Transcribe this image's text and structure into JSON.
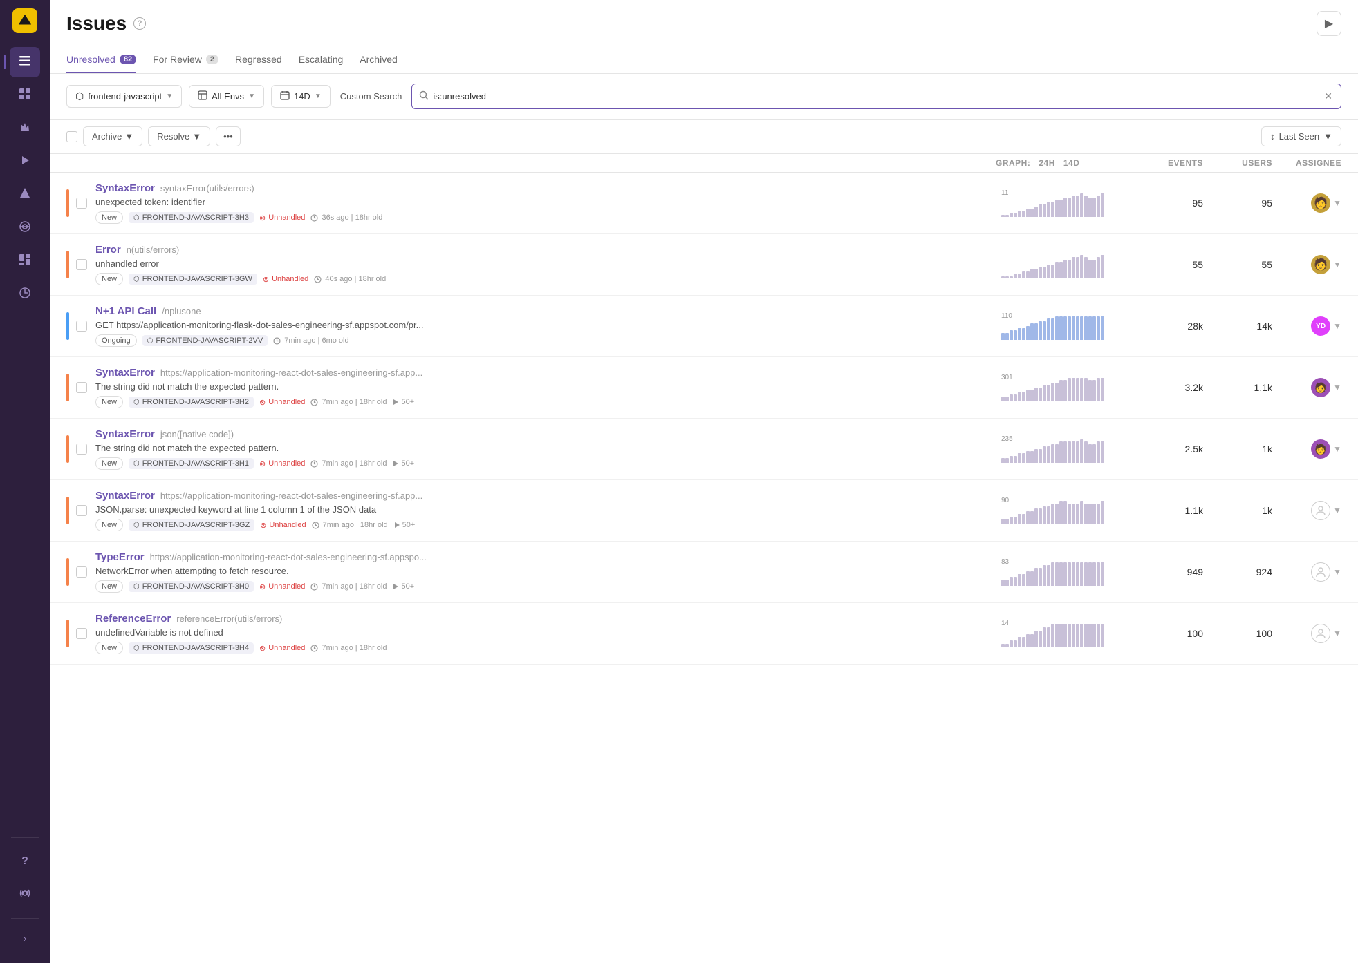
{
  "sidebar": {
    "logo_icon": "◆",
    "items": [
      {
        "id": "issues",
        "icon": "☰",
        "active": true
      },
      {
        "id": "releases",
        "icon": "▣"
      },
      {
        "id": "performance",
        "icon": "⚡"
      },
      {
        "id": "replays",
        "icon": "▶"
      },
      {
        "id": "alerts",
        "icon": "🔔"
      },
      {
        "id": "discover",
        "icon": "⊞"
      },
      {
        "id": "dashboards",
        "icon": "▦"
      },
      {
        "id": "crons",
        "icon": "⏱"
      }
    ],
    "bottom_items": [
      {
        "id": "help",
        "icon": "?"
      },
      {
        "id": "broadcasts",
        "icon": "📡"
      }
    ],
    "collapse_icon": "‹"
  },
  "header": {
    "title": "Issues",
    "help_icon": "?",
    "play_icon": "▶"
  },
  "tabs": [
    {
      "id": "unresolved",
      "label": "Unresolved",
      "badge": "82",
      "active": true
    },
    {
      "id": "for-review",
      "label": "For Review",
      "badge": "2",
      "active": false
    },
    {
      "id": "regressed",
      "label": "Regressed",
      "badge": null,
      "active": false
    },
    {
      "id": "escalating",
      "label": "Escalating",
      "badge": null,
      "active": false
    },
    {
      "id": "archived",
      "label": "Archived",
      "badge": null,
      "active": false
    }
  ],
  "filters": {
    "project": "frontend-javascript",
    "project_icon": "⬡",
    "env": "All Envs",
    "time": "14D",
    "custom_search_label": "Custom Search",
    "search_placeholder": "is:unresolved",
    "search_value": "is:unresolved"
  },
  "actions": {
    "archive_label": "Archive",
    "resolve_label": "Resolve",
    "more_icon": "•••",
    "sort_label": "Last Seen",
    "sort_icon": "↕"
  },
  "table_headers": {
    "graph_label": "GRAPH:",
    "graph_24h": "24h",
    "graph_14d": "14d",
    "events": "EVENTS",
    "users": "USERS",
    "assignee": "ASSIGNEE"
  },
  "issues": [
    {
      "id": 1,
      "priority": "orange",
      "type": "SyntaxError",
      "location": "syntaxError(utils/errors)",
      "description": "unexpected token: identifier",
      "badge_status": "New",
      "project_code": "FRONTEND-JAVASCRIPT-3H3",
      "unhandled": true,
      "time": "36s ago",
      "age": "18hr old",
      "plays": null,
      "graph_max": "11",
      "graph_bars": [
        1,
        1,
        2,
        2,
        3,
        3,
        4,
        4,
        5,
        6,
        6,
        7,
        7,
        8,
        8,
        9,
        9,
        10,
        10,
        11,
        10,
        9,
        9,
        10,
        11
      ],
      "events": "95",
      "users": "95",
      "assignee_type": "avatar",
      "assignee_color": "#c4a03a"
    },
    {
      "id": 2,
      "priority": "orange",
      "type": "Error",
      "location": "n(utils/errors)",
      "description": "unhandled error",
      "badge_status": "New",
      "project_code": "FRONTEND-JAVASCRIPT-3GW",
      "unhandled": true,
      "time": "40s ago",
      "age": "18hr old",
      "plays": null,
      "graph_max": "",
      "graph_bars": [
        1,
        1,
        1,
        2,
        2,
        3,
        3,
        4,
        4,
        5,
        5,
        6,
        6,
        7,
        7,
        8,
        8,
        9,
        9,
        10,
        9,
        8,
        8,
        9,
        10
      ],
      "events": "55",
      "users": "55",
      "assignee_type": "avatar",
      "assignee_color": "#c4a03a"
    },
    {
      "id": 3,
      "priority": "blue",
      "type": "N+1 API Call",
      "location": "/nplusone",
      "description": "GET https://application-monitoring-flask-dot-sales-engineering-sf.appspot.com/pr...",
      "badge_status": "Ongoing",
      "project_code": "FRONTEND-JAVASCRIPT-2VV",
      "unhandled": false,
      "time": "7min ago",
      "age": "6mo old",
      "plays": null,
      "graph_max": "110",
      "graph_bars": [
        3,
        3,
        4,
        4,
        5,
        5,
        6,
        7,
        7,
        8,
        8,
        9,
        9,
        10,
        10,
        10,
        10,
        10,
        10,
        10,
        10,
        10,
        10,
        10,
        10
      ],
      "events": "28k",
      "users": "14k",
      "assignee_type": "yd",
      "assignee_initials": "YD",
      "assignee_color": "#e040fb"
    },
    {
      "id": 4,
      "priority": "orange",
      "type": "SyntaxError",
      "location": "https://application-monitoring-react-dot-sales-engineering-sf.app...",
      "description": "The string did not match the expected pattern.",
      "badge_status": "New",
      "project_code": "FRONTEND-JAVASCRIPT-3H2",
      "unhandled": true,
      "time": "7min ago",
      "age": "18hr old",
      "plays": "50+",
      "graph_max": "301",
      "graph_bars": [
        2,
        2,
        3,
        3,
        4,
        4,
        5,
        5,
        6,
        6,
        7,
        7,
        8,
        8,
        9,
        9,
        10,
        10,
        10,
        10,
        10,
        9,
        9,
        10,
        10
      ],
      "events": "3.2k",
      "users": "1.1k",
      "assignee_type": "avatar-purple",
      "assignee_color": "#9c4fb5"
    },
    {
      "id": 5,
      "priority": "orange",
      "type": "SyntaxError",
      "location": "json([native code])",
      "description": "The string did not match the expected pattern.",
      "badge_status": "New",
      "project_code": "FRONTEND-JAVASCRIPT-3H1",
      "unhandled": true,
      "time": "7min ago",
      "age": "18hr old",
      "plays": "50+",
      "graph_max": "235",
      "graph_bars": [
        2,
        2,
        3,
        3,
        4,
        4,
        5,
        5,
        6,
        6,
        7,
        7,
        8,
        8,
        9,
        9,
        9,
        9,
        9,
        10,
        9,
        8,
        8,
        9,
        9
      ],
      "events": "2.5k",
      "users": "1k",
      "assignee_type": "avatar-purple",
      "assignee_color": "#9c4fb5"
    },
    {
      "id": 6,
      "priority": "orange",
      "type": "SyntaxError",
      "location": "https://application-monitoring-react-dot-sales-engineering-sf.app...",
      "description": "JSON.parse: unexpected keyword at line 1 column 1 of the JSON data",
      "badge_status": "New",
      "project_code": "FRONTEND-JAVASCRIPT-3GZ",
      "unhandled": true,
      "time": "7min ago",
      "age": "18hr old",
      "plays": "50+",
      "graph_max": "90",
      "graph_bars": [
        2,
        2,
        3,
        3,
        4,
        4,
        5,
        5,
        6,
        6,
        7,
        7,
        8,
        8,
        9,
        9,
        8,
        8,
        8,
        9,
        8,
        8,
        8,
        8,
        9
      ],
      "events": "1.1k",
      "users": "1k",
      "assignee_type": "placeholder",
      "assignee_color": null
    },
    {
      "id": 7,
      "priority": "orange",
      "type": "TypeError",
      "location": "https://application-monitoring-react-dot-sales-engineering-sf.appspo...",
      "description": "NetworkError when attempting to fetch resource.",
      "badge_status": "New",
      "project_code": "FRONTEND-JAVASCRIPT-3H0",
      "unhandled": true,
      "time": "7min ago",
      "age": "18hr old",
      "plays": "50+",
      "graph_max": "83",
      "graph_bars": [
        2,
        2,
        3,
        3,
        4,
        4,
        5,
        5,
        6,
        6,
        7,
        7,
        8,
        8,
        8,
        8,
        8,
        8,
        8,
        8,
        8,
        8,
        8,
        8,
        8
      ],
      "events": "949",
      "users": "924",
      "assignee_type": "placeholder",
      "assignee_color": null
    },
    {
      "id": 8,
      "priority": "orange",
      "type": "ReferenceError",
      "location": "referenceError(utils/errors)",
      "description": "undefinedVariable is not defined",
      "badge_status": "New",
      "project_code": "FRONTEND-JAVASCRIPT-3H4",
      "unhandled": true,
      "time": "7min ago",
      "age": "18hr old",
      "plays": null,
      "graph_max": "14",
      "graph_bars": [
        1,
        1,
        2,
        2,
        3,
        3,
        4,
        4,
        5,
        5,
        6,
        6,
        7,
        7,
        7,
        7,
        7,
        7,
        7,
        7,
        7,
        7,
        7,
        7,
        7
      ],
      "events": "100",
      "users": "100",
      "assignee_type": "placeholder",
      "assignee_color": null
    }
  ]
}
